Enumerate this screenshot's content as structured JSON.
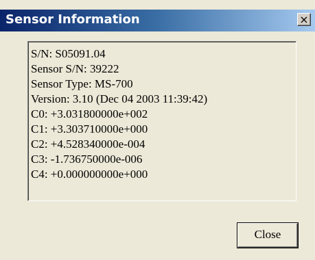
{
  "window": {
    "title": "Sensor Information",
    "close_glyph": "×",
    "title_gradient": [
      "#0a246a",
      "#a6caf0"
    ]
  },
  "info": {
    "lines": [
      "S/N: S05091.04",
      "Sensor S/N: 39222",
      "Sensor Type: MS-700",
      "Version: 3.10 (Dec 04 2003 11:39:42)",
      "C0: +3.031800000e+002",
      "C1: +3.303710000e+000",
      "C2: +4.528340000e-004",
      "C3: -1.736750000e-006",
      "C4: +0.000000000e+000"
    ]
  },
  "buttons": {
    "close_label": "Close"
  }
}
